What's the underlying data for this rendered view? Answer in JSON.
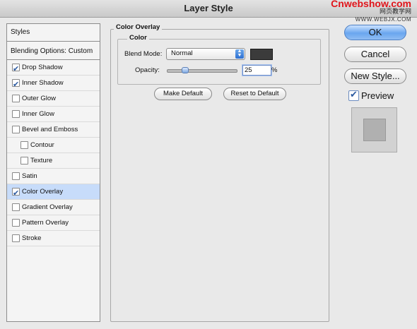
{
  "window": {
    "title": "Layer Style"
  },
  "watermark": {
    "line1": "Cnwebshow.com",
    "line2": "网页教学网",
    "line3": "WWW.WEBJX.COM"
  },
  "sidebar": {
    "header": "Styles",
    "blending": "Blending Options: Custom",
    "items": [
      {
        "label": "Drop Shadow",
        "checked": true
      },
      {
        "label": "Inner Shadow",
        "checked": true
      },
      {
        "label": "Outer Glow",
        "checked": false
      },
      {
        "label": "Inner Glow",
        "checked": false
      },
      {
        "label": "Bevel and Emboss",
        "checked": false
      },
      {
        "label": "Contour",
        "checked": false,
        "indent": true
      },
      {
        "label": "Texture",
        "checked": false,
        "indent": true
      },
      {
        "label": "Satin",
        "checked": false
      },
      {
        "label": "Color Overlay",
        "checked": true,
        "selected": true
      },
      {
        "label": "Gradient Overlay",
        "checked": false
      },
      {
        "label": "Pattern Overlay",
        "checked": false
      },
      {
        "label": "Stroke",
        "checked": false
      }
    ]
  },
  "panel": {
    "title": "Color Overlay",
    "group_title": "Color",
    "blend_mode_label": "Blend Mode:",
    "blend_mode_value": "Normal",
    "overlay_color": "#3b3b3b",
    "opacity_label": "Opacity:",
    "opacity_value": "25",
    "opacity_unit": "%",
    "make_default": "Make Default",
    "reset_default": "Reset to Default"
  },
  "buttons": {
    "ok": "OK",
    "cancel": "Cancel",
    "new_style": "New Style..."
  },
  "preview": {
    "label": "Preview",
    "checked": true
  }
}
